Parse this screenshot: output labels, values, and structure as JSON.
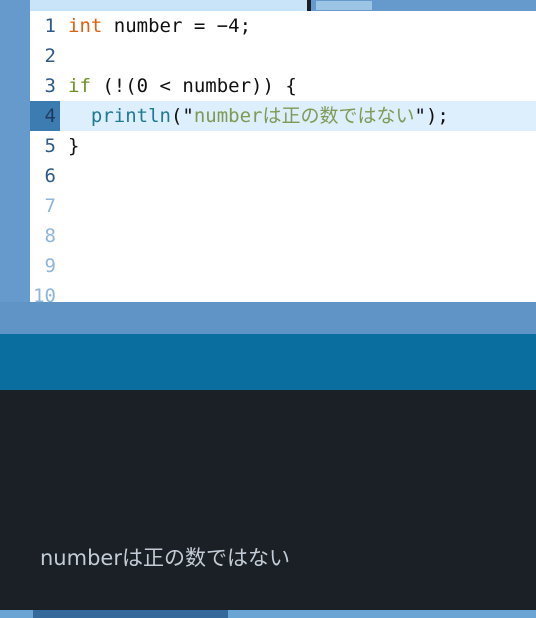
{
  "window": {
    "title": "code-editor-with-console"
  },
  "tabbar": {
    "active_tab_label": "",
    "inactive_tab_label": ""
  },
  "editor": {
    "language": "kotlin",
    "highlighted_line": 4,
    "total_gutter_lines": 10,
    "colors": {
      "gutter_background": "#6699cc",
      "gutter_number": "#2f5a87",
      "gutter_number_dim": "#8fb6da",
      "active_line_gutter": "#3d7cb0",
      "active_line_background": "#ddeefc",
      "editor_background": "#ffffff",
      "keyword_type": "#e06010",
      "keyword_control": "#6f9123",
      "function_name": "#1f7a94",
      "string_literal": "#7f9a54",
      "plain_text": "#101010"
    },
    "lines": [
      {
        "number": "1",
        "dim": false,
        "tokens": [
          {
            "text": "int",
            "kind": "kw-type"
          },
          {
            "text": " number = −4;",
            "kind": "plain"
          }
        ]
      },
      {
        "number": "2",
        "dim": false,
        "tokens": []
      },
      {
        "number": "3",
        "dim": false,
        "tokens": [
          {
            "text": "if",
            "kind": "kw-ctrl"
          },
          {
            "text": " (!(0 < number)) {",
            "kind": "plain"
          }
        ]
      },
      {
        "number": "4",
        "dim": false,
        "tokens": [
          {
            "text": "  ",
            "kind": "plain"
          },
          {
            "text": "println",
            "kind": "fn"
          },
          {
            "text": "(\"",
            "kind": "plain"
          },
          {
            "text": "numberは正の数ではない",
            "kind": "str"
          },
          {
            "text": "\");",
            "kind": "plain"
          }
        ]
      },
      {
        "number": "5",
        "dim": false,
        "tokens": [
          {
            "text": "}",
            "kind": "plain"
          }
        ]
      },
      {
        "number": "6",
        "dim": false,
        "tokens": []
      },
      {
        "number": "7",
        "dim": true,
        "tokens": []
      },
      {
        "number": "8",
        "dim": true,
        "tokens": []
      },
      {
        "number": "9",
        "dim": true,
        "tokens": []
      },
      {
        "number": "10",
        "dim": true,
        "tokens": []
      }
    ]
  },
  "console": {
    "output": "numberは正の数ではない",
    "background": "#1b2026",
    "text_color": "#c3ccd6"
  },
  "bands": {
    "upper_blue": "#6093c6",
    "lower_teal": "#0a6e9e"
  },
  "statusbar": {
    "background": "#6aa4d4",
    "segment_color": "#35689b",
    "label": ""
  }
}
